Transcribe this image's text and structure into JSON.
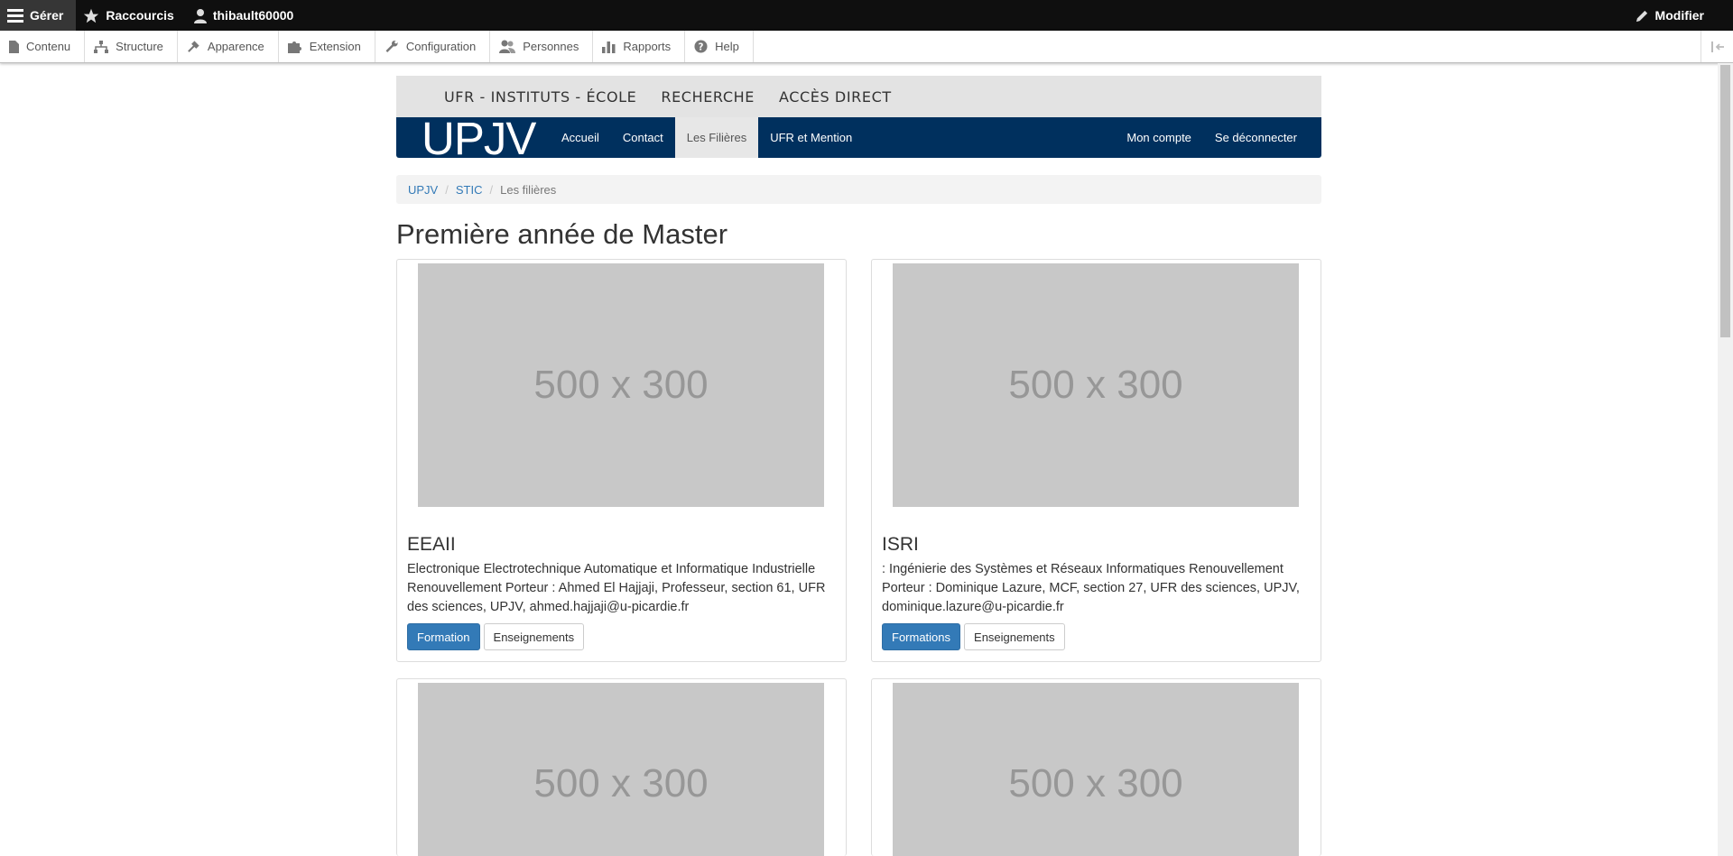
{
  "admin_toolbar": {
    "manage": "Gérer",
    "shortcuts": "Raccourcis",
    "user": "thibault60000",
    "edit": "Modifier"
  },
  "admin_tray": [
    {
      "label": "Contenu",
      "icon": "file-icon"
    },
    {
      "label": "Structure",
      "icon": "structure-icon"
    },
    {
      "label": "Apparence",
      "icon": "wrench-icon"
    },
    {
      "label": "Extension",
      "icon": "puzzle-icon"
    },
    {
      "label": "Configuration",
      "icon": "config-icon"
    },
    {
      "label": "Personnes",
      "icon": "people-icon"
    },
    {
      "label": "Rapports",
      "icon": "reports-icon"
    },
    {
      "label": "Help",
      "icon": "help-icon"
    }
  ],
  "top_links": [
    "UFR - INSTITUTS - ÉCOLE",
    "RECHERCHE",
    "ACCÈS DIRECT"
  ],
  "navbar": {
    "brand": "UPJV",
    "items": [
      "Accueil",
      "Contact",
      "Les Filières",
      "UFR et Mention"
    ],
    "right": [
      "Mon compte",
      "Se déconnecter"
    ]
  },
  "breadcrumb": {
    "items": [
      "UPJV",
      "STIC"
    ],
    "current": "Les filières"
  },
  "page_title": "Première année de Master",
  "cards": [
    {
      "image": "500 x 300",
      "title": "EEAII",
      "description": "Electronique Electrotechnique Automatique et Informatique Industrielle Renouvellement Porteur : Ahmed El Hajjaji, Professeur, section 61, UFR des sciences, UPJV, ahmed.hajjaji@u-picardie.fr",
      "primary": "Formation",
      "secondary": "Enseignements"
    },
    {
      "image": "500 x 300",
      "title": "ISRI",
      "description": ": Ingénierie des Systèmes et Réseaux Informatiques Renouvellement Porteur : Dominique Lazure, MCF, section 27, UFR des sciences, UPJV, dominique.lazure@u-picardie.fr",
      "primary": "Formations",
      "secondary": "Enseignements"
    },
    {
      "image": "500 x 300"
    },
    {
      "image": "500 x 300"
    }
  ]
}
